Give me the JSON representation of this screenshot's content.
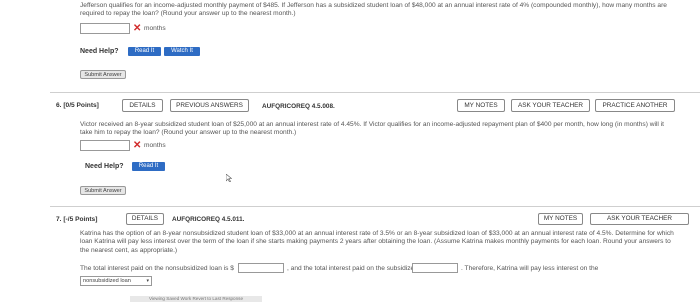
{
  "q5": {
    "text_line1": "Jefferson qualifies for an income-adjusted monthly payment of $485. If Jefferson has a subsidized student loan of $48,000 at an annual interest rate of 4% (compounded monthly), how many months are",
    "text_line2": "required to repay the loan? (Round your answer up to the nearest month.)",
    "unit": "months",
    "need_help": "Need Help?",
    "read_it": "Read It",
    "watch_it": "Watch It",
    "submit": "Submit Answer"
  },
  "q6": {
    "number": "6.",
    "points": "[0/5 Points]",
    "details": "DETAILS",
    "previous": "PREVIOUS ANSWERS",
    "code": "AUFQRICOREQ 4.5.008.",
    "my_notes": "MY NOTES",
    "ask_teacher": "ASK YOUR TEACHER",
    "practice": "PRACTICE ANOTHER",
    "text_line1": "Victor received an 8-year subsidized student loan of $25,000 at an annual interest rate of 4.45%. If Victor qualifies for an income-adjusted repayment plan of $400 per month, how long (in months) will it",
    "text_line2": "take him to repay the loan? (Round your answer up to the nearest month.)",
    "unit": "months",
    "need_help": "Need Help?",
    "read_it": "Read It",
    "submit": "Submit Answer"
  },
  "q7": {
    "number": "7.",
    "points": "[-/5 Points]",
    "details": "DETAILS",
    "code": "AUFQRICOREQ 4.5.011.",
    "my_notes": "MY NOTES",
    "ask_teacher": "ASK YOUR TEACHER",
    "text_line1": "Katrina has the option of an 8-year nonsubsidized student loan of $33,000 at an annual interest rate of 3.5% or an 8-year subsidized loan of $33,000 at an annual interest rate of 4.5%. Determine for which",
    "text_line2": "loan Katrina will pay less interest over the term of the loan if she starts making payments 2 years after obtaining the loan. (Assume Katrina makes monthly payments for each loan. Round your answers to",
    "text_line3": "the nearest cent, as appropriate.)",
    "answer_prefix": "The total interest paid on the nonsubsidized loan is $",
    "answer_middle": ", and the total interest paid on the subsidized loan is $",
    "answer_suffix": ". Therefore, Katrina will pay less interest on the",
    "select_value": "nonsubsidized loan",
    "bottom_bar": "Viewing Saved Work Revert to Last Response"
  }
}
